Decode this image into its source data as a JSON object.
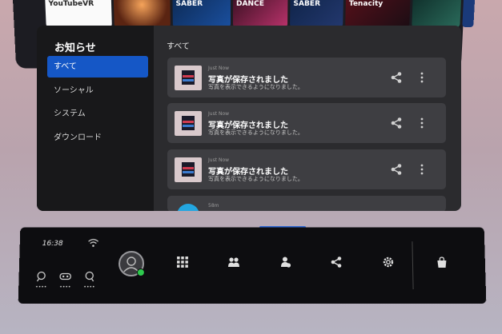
{
  "background_tiles": [
    {
      "label": "YouTubeVR"
    },
    {
      "label": ""
    },
    {
      "label": "SABER"
    },
    {
      "label": "DANCE"
    },
    {
      "label": "SABER"
    },
    {
      "label": "Tenacity"
    },
    {
      "label": ""
    },
    {
      "label": ""
    }
  ],
  "sidebar": {
    "title": "お知らせ",
    "items": [
      {
        "label": "すべて",
        "active": true
      },
      {
        "label": "ソーシャル",
        "active": false
      },
      {
        "label": "システム",
        "active": false
      },
      {
        "label": "ダウンロード",
        "active": false
      }
    ]
  },
  "main": {
    "title": "すべて",
    "notifications": [
      {
        "time": "Just Now",
        "title": "写真が保存されました",
        "body": "写真を表示できるようになりました。"
      },
      {
        "time": "Just Now",
        "title": "写真が保存されました",
        "body": "写真を表示できるようになりました。"
      },
      {
        "time": "Just Now",
        "title": "写真が保存されました",
        "body": "写真を表示できるようになりました。"
      },
      {
        "time": "58m",
        "title": "",
        "body": ""
      }
    ]
  },
  "dock": {
    "clock": "16:38",
    "mini_status_dots": [
      "••••",
      "••••",
      "••••"
    ],
    "icons": [
      "apps-grid-icon",
      "people-icon",
      "party-icon",
      "share-icon",
      "settings-icon",
      "store-bag-icon"
    ]
  },
  "colors": {
    "accent": "#1557c6",
    "panel": "#2b2b2e",
    "sidebar": "#18181a",
    "card": "#3e3e42",
    "online": "#2ec94e"
  }
}
